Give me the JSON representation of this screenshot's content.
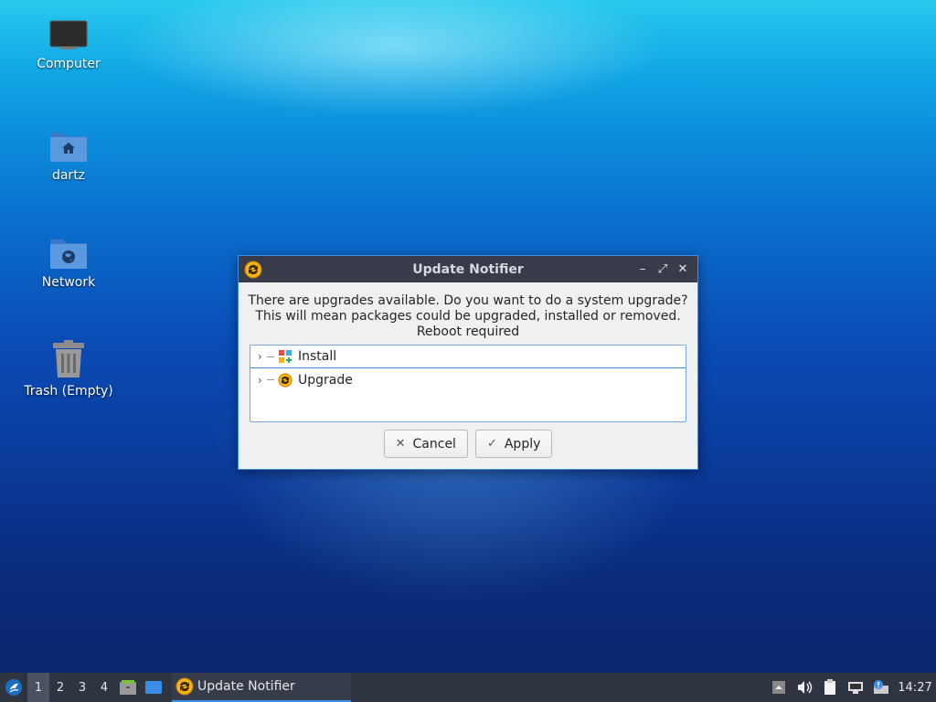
{
  "desktop": {
    "icons": [
      {
        "label": "Computer",
        "icon": "computer-icon"
      },
      {
        "label": "dartz",
        "icon": "home-folder-icon"
      },
      {
        "label": "Network",
        "icon": "network-folder-icon"
      },
      {
        "label": "Trash (Empty)",
        "icon": "trash-icon"
      }
    ]
  },
  "dialog": {
    "title": "Update Notifier",
    "message_line1": "There are upgrades available. Do you want to do a system upgrade?",
    "message_line2": "This will mean packages could be upgraded, installed or removed.",
    "message_line3": "Reboot required",
    "tree": [
      {
        "label": "Install",
        "icon": "install-packages-icon"
      },
      {
        "label": "Upgrade",
        "icon": "upgrade-icon"
      }
    ],
    "cancel_label": "Cancel",
    "apply_label": "Apply",
    "colors": {
      "titlebar": "#383c4a",
      "accent": "#3d8ee6"
    }
  },
  "taskbar": {
    "workspaces": [
      "1",
      "2",
      "3",
      "4"
    ],
    "active_workspace": "1",
    "task_label": "Update Notifier",
    "clock": "14:27"
  }
}
